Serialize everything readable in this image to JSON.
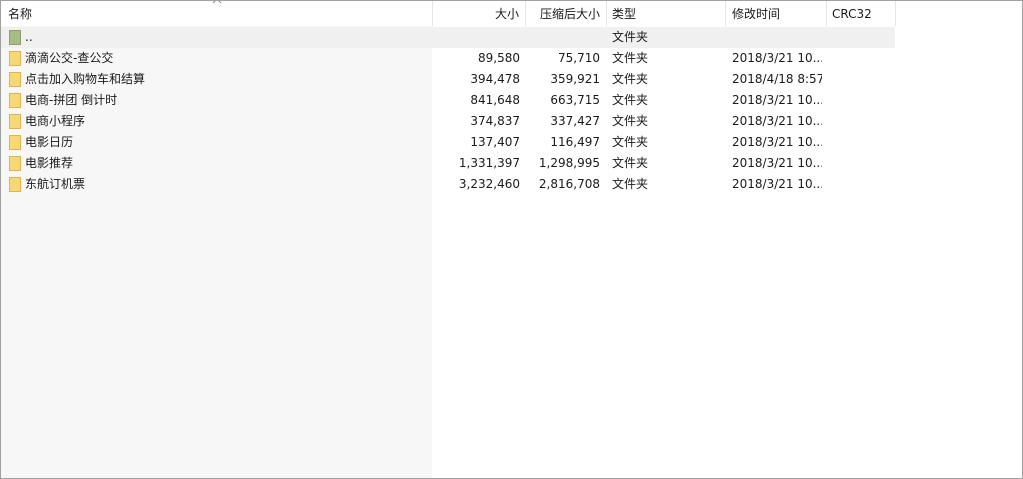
{
  "columns": {
    "name": "名称",
    "size": "大小",
    "packed": "压缩后大小",
    "type": "类型",
    "modified": "修改时间",
    "crc": "CRC32"
  },
  "sort": {
    "column": "name",
    "icon": "sort-up-arrow-icon"
  },
  "parent": {
    "name": "..",
    "type": "文件夹",
    "icon": "parent-folder-icon"
  },
  "files": [
    {
      "name": "滴滴公交-查公交",
      "size": "89,580",
      "packed": "75,710",
      "type": "文件夹",
      "modified": "2018/3/21 10...",
      "icon": "folder-icon"
    },
    {
      "name": "点击加入购物车和结算",
      "size": "394,478",
      "packed": "359,921",
      "type": "文件夹",
      "modified": "2018/4/18 8:57",
      "icon": "folder-icon"
    },
    {
      "name": "电商-拼团 倒计时",
      "size": "841,648",
      "packed": "663,715",
      "type": "文件夹",
      "modified": "2018/3/21 10...",
      "icon": "folder-icon"
    },
    {
      "name": "电商小程序",
      "size": "374,837",
      "packed": "337,427",
      "type": "文件夹",
      "modified": "2018/3/21 10...",
      "icon": "folder-icon"
    },
    {
      "name": "电影日历",
      "size": "137,407",
      "packed": "116,497",
      "type": "文件夹",
      "modified": "2018/3/21 10...",
      "icon": "folder-icon"
    },
    {
      "name": "电影推荐",
      "size": "1,331,397",
      "packed": "1,298,995",
      "type": "文件夹",
      "modified": "2018/3/21 10...",
      "icon": "folder-icon"
    },
    {
      "name": "东航订机票",
      "size": "3,232,460",
      "packed": "2,816,708",
      "type": "文件夹",
      "modified": "2018/3/21 10...",
      "icon": "folder-icon"
    }
  ],
  "colors": {
    "folder": "#f8d775",
    "folder_edge": "#e0b64a",
    "parent_folder": "#a8bb86",
    "name_column_bg": "#f7f7f7",
    "parent_row_bg": "#f0f0f0"
  }
}
